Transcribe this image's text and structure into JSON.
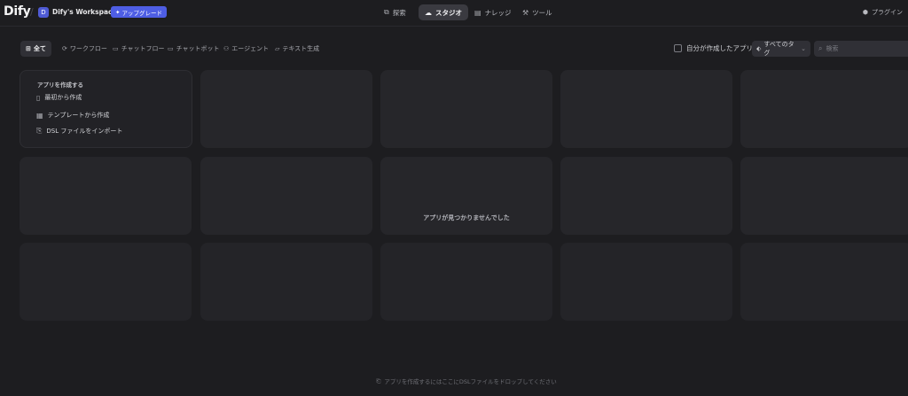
{
  "header": {
    "logo": "Dify",
    "workspace_initial": "D",
    "workspace_name": "Dify's Workspace",
    "upgrade_label": "アップグレード",
    "nav": [
      {
        "label": "探索",
        "icon": "explore-icon"
      },
      {
        "label": "スタジオ",
        "icon": "studio-icon",
        "active": true
      },
      {
        "label": "ナレッジ",
        "icon": "knowledge-icon"
      },
      {
        "label": "ツール",
        "icon": "tools-icon"
      }
    ],
    "plugin_label": "プラグイン"
  },
  "filters": {
    "tabs": [
      {
        "label": "全て",
        "active": true
      },
      {
        "label": "ワークフロー"
      },
      {
        "label": "チャットフロー"
      },
      {
        "label": "チャットボット"
      },
      {
        "label": "エージェント"
      },
      {
        "label": "テキスト生成"
      }
    ],
    "mine_label": "自分が作成したアプリ",
    "tag_label": "すべてのタグ",
    "search_placeholder": "検索"
  },
  "create_card": {
    "title": "アプリを作成する",
    "items": [
      "最初から作成",
      "テンプレートから作成",
      "DSL ファイルをインポート"
    ]
  },
  "empty_message": "アプリが見つかりませんでした",
  "drop_hint": "アプリを作成するにはここにDSLファイルをドロップしてください",
  "colors": {
    "background": "#1d1d20",
    "card": "#26262a",
    "accent": "#4e5ee4"
  }
}
